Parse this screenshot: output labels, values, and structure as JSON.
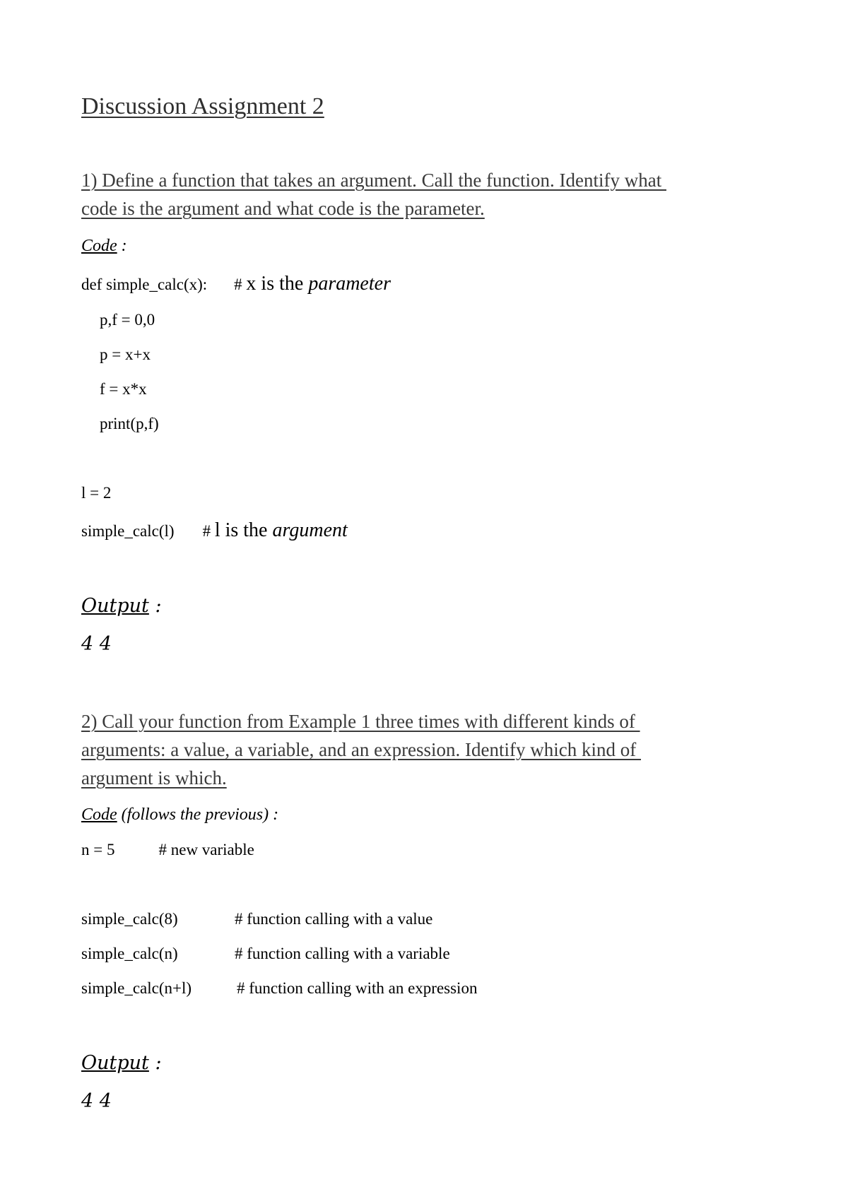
{
  "document": {
    "title": "Discussion Assignment 2",
    "section1": {
      "heading_line1": "1) Define a function that takes an argument. Call the function. Identify what ",
      "heading_line2": "code is the argument and what code is the parameter.",
      "code_label": "Code",
      "code_label_suffix": " :",
      "code": {
        "def_line": "def simple_calc(x):",
        "def_comment_hash": "# ",
        "def_comment_text": "x is the ",
        "def_comment_emph": "parameter",
        "body": [
          "p,f = 0,0",
          "p = x+x",
          "f = x*x",
          "print(p,f)"
        ],
        "assign_line": "l = 2",
        "call_line": "simple_calc(l)",
        "call_comment_hash": "# ",
        "call_comment_text": "l is the ",
        "call_comment_emph": "argument"
      },
      "output_label": "Output",
      "output_label_suffix": " :",
      "output_value": "4 4"
    },
    "section2": {
      "heading_line1": "2) Call your function from Example 1 three times with different kinds of ",
      "heading_line2": "arguments: a value, a variable, and an expression. Identify which kind of ",
      "heading_line3": "argument is which.",
      "code_label": "Code",
      "code_label_suffix": " (follows the previous) :",
      "code": {
        "assign_line": "n = 5",
        "assign_comment": "# new variable",
        "calls": [
          {
            "call": "simple_calc(8)",
            "comment": "# function calling with a value"
          },
          {
            "call": "simple_calc(n)",
            "comment": "# function calling with a variable"
          },
          {
            "call": "simple_calc(n+l)",
            "comment": "# function calling with an expression"
          }
        ]
      },
      "output_label": "Output",
      "output_label_suffix": " :",
      "output_value": "4 4"
    }
  }
}
